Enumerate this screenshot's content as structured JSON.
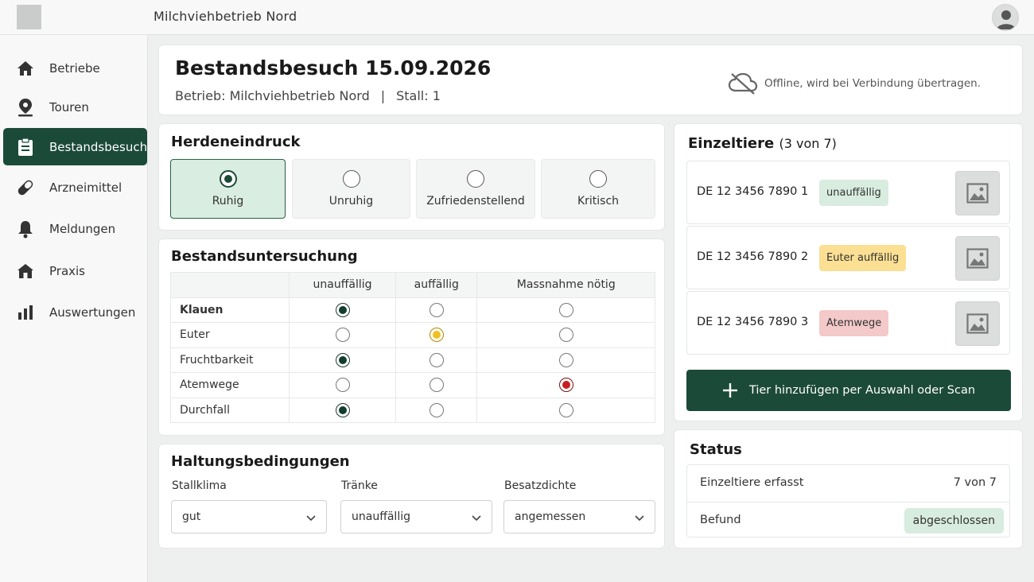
{
  "app": {
    "title": "Milchviehbetrieb Nord"
  },
  "sidebar": {
    "items": [
      {
        "label": "Betriebe",
        "icon": "home-icon",
        "active": false
      },
      {
        "label": "Touren",
        "icon": "map-pin-icon",
        "active": false
      },
      {
        "label": "Bestandsbesuch",
        "icon": "clipboard-icon",
        "active": true
      },
      {
        "label": "Arzneimittel",
        "icon": "pill-icon",
        "active": false
      },
      {
        "label": "Meldungen",
        "icon": "bell-icon",
        "active": false
      },
      {
        "label": "Praxis",
        "icon": "building-icon",
        "active": false
      },
      {
        "label": "Auswertungen",
        "icon": "bar-chart-icon",
        "active": false
      }
    ]
  },
  "visit": {
    "title": "Bestandsbesuch 15.09.2026",
    "farm": "Betrieb: Milchviehbetrieb Nord",
    "separator": "|",
    "stall": "Stall: 1",
    "offline_text": "Offline, wird bei Verbindung übertragen."
  },
  "herd": {
    "title": "Herdeneindruck",
    "options": [
      "Ruhig",
      "Unruhig",
      "Zufriedenstellend",
      "Kritisch"
    ],
    "selected": "Ruhig"
  },
  "exam": {
    "title": "Bestandsuntersuchung",
    "columns": [
      "unauffällig",
      "auffällig",
      "Massnahme nötig"
    ],
    "rows": [
      {
        "label": "Klauen",
        "selected": "unauffällig"
      },
      {
        "label": "Euter",
        "selected": "auffällig"
      },
      {
        "label": "Fruchtbarkeit",
        "selected": "unauffällig"
      },
      {
        "label": "Atemwege",
        "selected": "Massnahme nötig"
      },
      {
        "label": "Durchfall",
        "selected": "unauffällig"
      }
    ]
  },
  "housing": {
    "title": "Haltungsbedingungen",
    "fields": [
      {
        "label": "Stallklima",
        "value": "gut"
      },
      {
        "label": "Tränke",
        "value": "unauffällig"
      },
      {
        "label": "Besatzdichte",
        "value": "angemessen"
      }
    ]
  },
  "animals": {
    "title": "Einzeltiere",
    "count": "(3 von 7)",
    "items": [
      {
        "ear_tag": "DE 12 3456 7890 1",
        "finding": "unauffällig",
        "severity": "ok"
      },
      {
        "ear_tag": "DE 12 3456 7890 2",
        "finding": "Euter auffällig",
        "severity": "warn"
      },
      {
        "ear_tag": "DE 12 3456 7890 3",
        "finding": "Atemwege",
        "severity": "bad"
      }
    ],
    "add_button": "Tier hinzufügen per Auswahl oder Scan"
  },
  "status": {
    "title": "Status",
    "rows": [
      {
        "label": "Einzeltiere erfasst",
        "value": "7 von 7"
      },
      {
        "label": "Befund",
        "value": "abgeschlossen"
      }
    ]
  },
  "colors": {
    "primary": "#1c4a39",
    "ok": "#d8ecdf",
    "warn": "#fbdf93",
    "bad": "#f4c9c9",
    "radio_yellow": "#f0c020",
    "radio_red": "#c81e1e"
  }
}
